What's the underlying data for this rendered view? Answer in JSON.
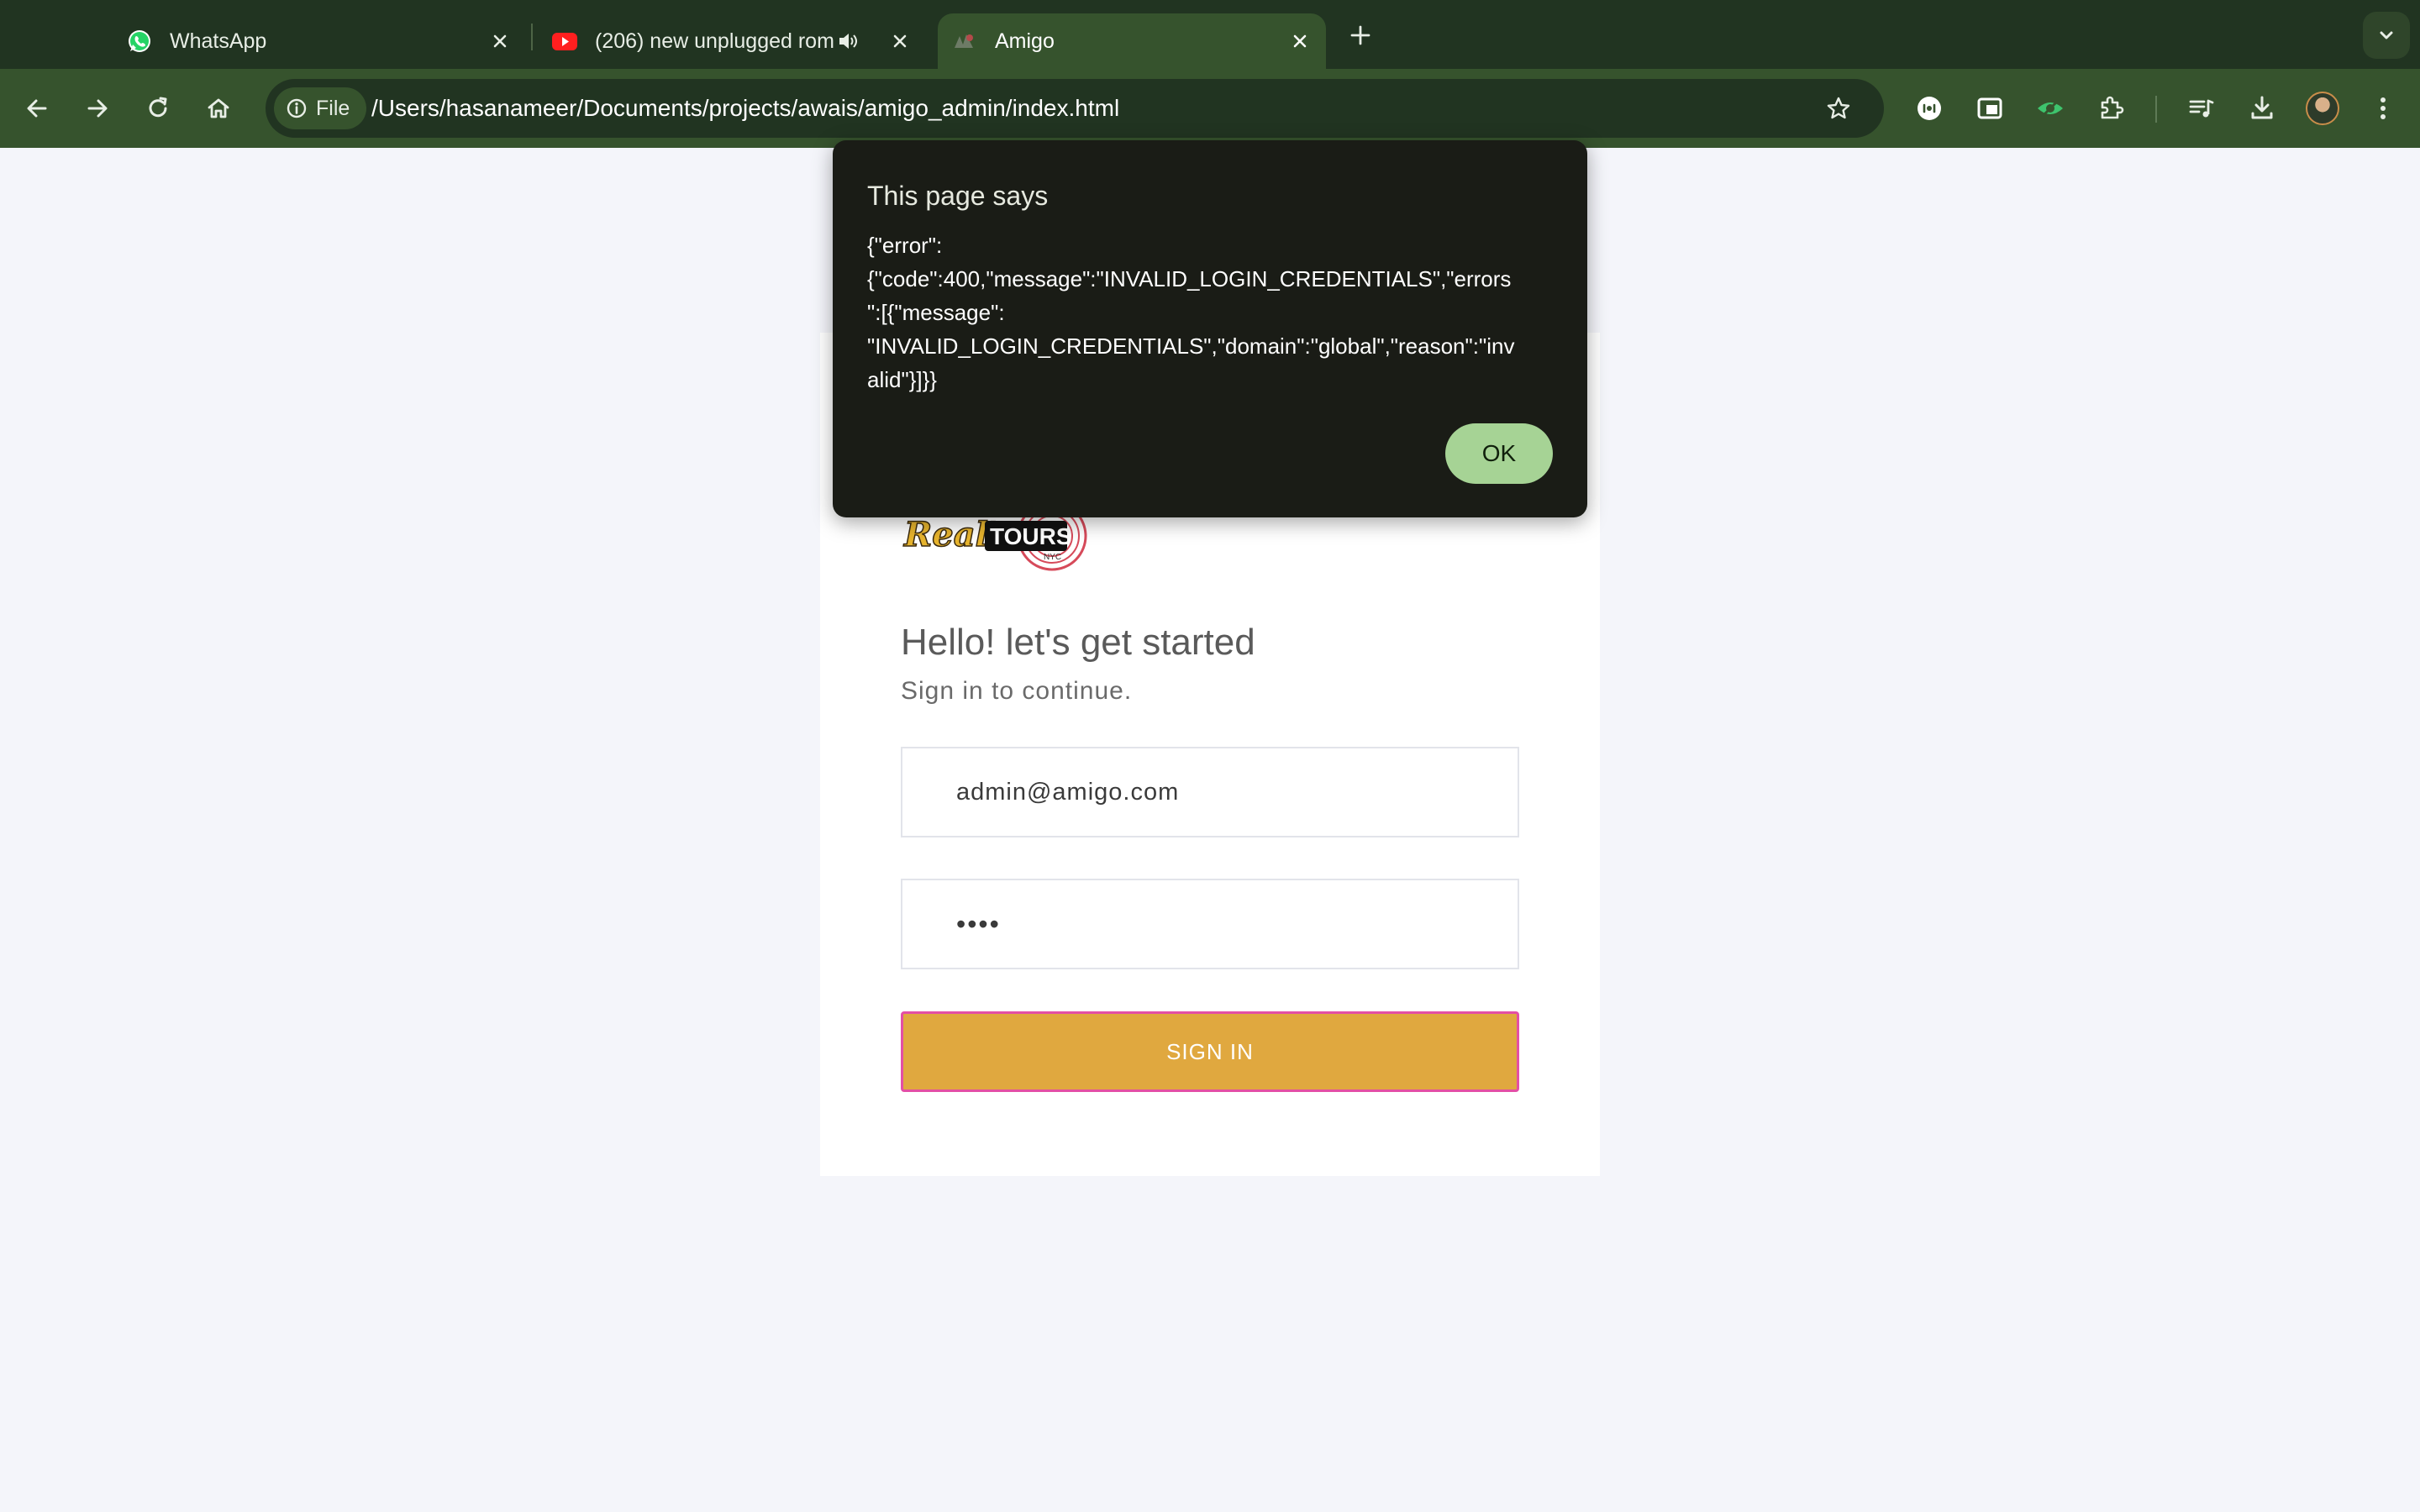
{
  "tabs": [
    {
      "title": "WhatsApp",
      "icon": "whatsapp-icon"
    },
    {
      "title": "(206) new unplugged rom",
      "icon": "youtube-icon",
      "audio": "speaker-icon"
    },
    {
      "title": "Amigo",
      "icon": "amigo-logo-icon",
      "active": true
    }
  ],
  "toolbar": {
    "chip_label": "File",
    "url": "/Users/hasanameer/Documents/projects/awais/amigo_admin/index.html"
  },
  "colors": {
    "tabstrip": "#213421",
    "toolbar": "#36532d",
    "page_bg": "#f4f5fa",
    "signin_bg": "#e0a83f",
    "signin_border": "#e34fa5",
    "dialog_bg": "#1a1c16",
    "ok_bg": "#a6d395"
  },
  "login": {
    "logo_text": "Real's TOURS",
    "heading": "Hello! let's get started",
    "subheading": "Sign in to continue.",
    "email_value": "admin@amigo.com",
    "password_value": "1234",
    "signin_label": "SIGN IN"
  },
  "dialog": {
    "title": "This page says",
    "message_lines": [
      "{\"error\":",
      "{\"code\":400,\"message\":\"INVALID_LOGIN_CREDENTIALS\",\"errors",
      "\":[{\"message\":",
      "\"INVALID_LOGIN_CREDENTIALS\",\"domain\":\"global\",\"reason\":\"inv",
      "alid\"}]}}"
    ],
    "ok_label": "OK"
  }
}
